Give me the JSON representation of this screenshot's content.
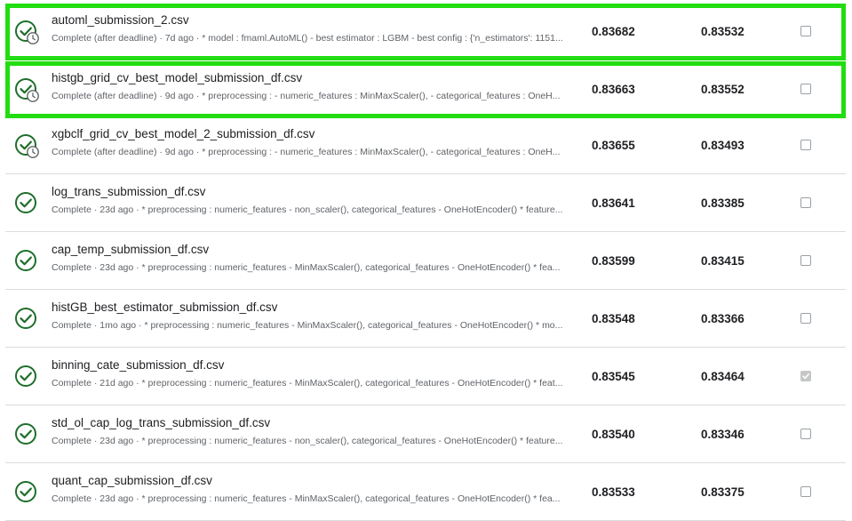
{
  "colors": {
    "highlight": "#22dd11",
    "success": "#1e6e2a"
  },
  "submissions": [
    {
      "name": "automl_submission_2.csv",
      "description": "Complete (after deadline) · 7d ago · * model : fmaml.AutoML() - best estimator : LGBM - best config : {'n_estimators': 1151...",
      "private_score": "0.83682",
      "public_score": "0.83532",
      "selected": false,
      "late": true,
      "highlighted": true,
      "icon": "check-circle-clock-icon"
    },
    {
      "name": "histgb_grid_cv_best_model_submission_df.csv",
      "description": "Complete (after deadline) · 9d ago · * preprocessing : - numeric_features : MinMaxScaler(), - categorical_features : OneH...",
      "private_score": "0.83663",
      "public_score": "0.83552",
      "selected": false,
      "late": true,
      "highlighted": true,
      "icon": "check-circle-clock-icon"
    },
    {
      "name": "xgbclf_grid_cv_best_model_2_submission_df.csv",
      "description": "Complete (after deadline) · 9d ago · * preprocessing : - numeric_features : MinMaxScaler(), - categorical_features : OneH...",
      "private_score": "0.83655",
      "public_score": "0.83493",
      "selected": false,
      "late": true,
      "highlighted": false,
      "icon": "check-circle-clock-icon"
    },
    {
      "name": "log_trans_submission_df.csv",
      "description": "Complete · 23d ago · * preprocessing : numeric_features - non_scaler(), categorical_features - OneHotEncoder() * feature...",
      "private_score": "0.83641",
      "public_score": "0.83385",
      "selected": false,
      "late": false,
      "highlighted": false,
      "icon": "check-circle-icon"
    },
    {
      "name": "cap_temp_submission_df.csv",
      "description": "Complete · 23d ago · * preprocessing : numeric_features - MinMaxScaler(), categorical_features - OneHotEncoder() * fea...",
      "private_score": "0.83599",
      "public_score": "0.83415",
      "selected": false,
      "late": false,
      "highlighted": false,
      "icon": "check-circle-icon"
    },
    {
      "name": "histGB_best_estimator_submission_df.csv",
      "description": "Complete · 1mo ago · * preprocessing : numeric_features - MinMaxScaler(), categorical_features - OneHotEncoder() * mo...",
      "private_score": "0.83548",
      "public_score": "0.83366",
      "selected": false,
      "late": false,
      "highlighted": false,
      "icon": "check-circle-icon"
    },
    {
      "name": "binning_cate_submission_df.csv",
      "description": "Complete · 21d ago · * preprocessing : numeric_features - MinMaxScaler(), categorical_features - OneHotEncoder() * feat...",
      "private_score": "0.83545",
      "public_score": "0.83464",
      "selected": true,
      "late": false,
      "highlighted": false,
      "icon": "check-circle-icon"
    },
    {
      "name": "std_ol_cap_log_trans_submission_df.csv",
      "description": "Complete · 23d ago · * preprocessing : numeric_features - non_scaler(), categorical_features - OneHotEncoder() * feature...",
      "private_score": "0.83540",
      "public_score": "0.83346",
      "selected": false,
      "late": false,
      "highlighted": false,
      "icon": "check-circle-icon"
    },
    {
      "name": "quant_cap_submission_df.csv",
      "description": "Complete · 23d ago · * preprocessing : numeric_features - MinMaxScaler(), categorical_features - OneHotEncoder() * fea...",
      "private_score": "0.83533",
      "public_score": "0.83375",
      "selected": false,
      "late": false,
      "highlighted": false,
      "icon": "check-circle-icon"
    }
  ]
}
